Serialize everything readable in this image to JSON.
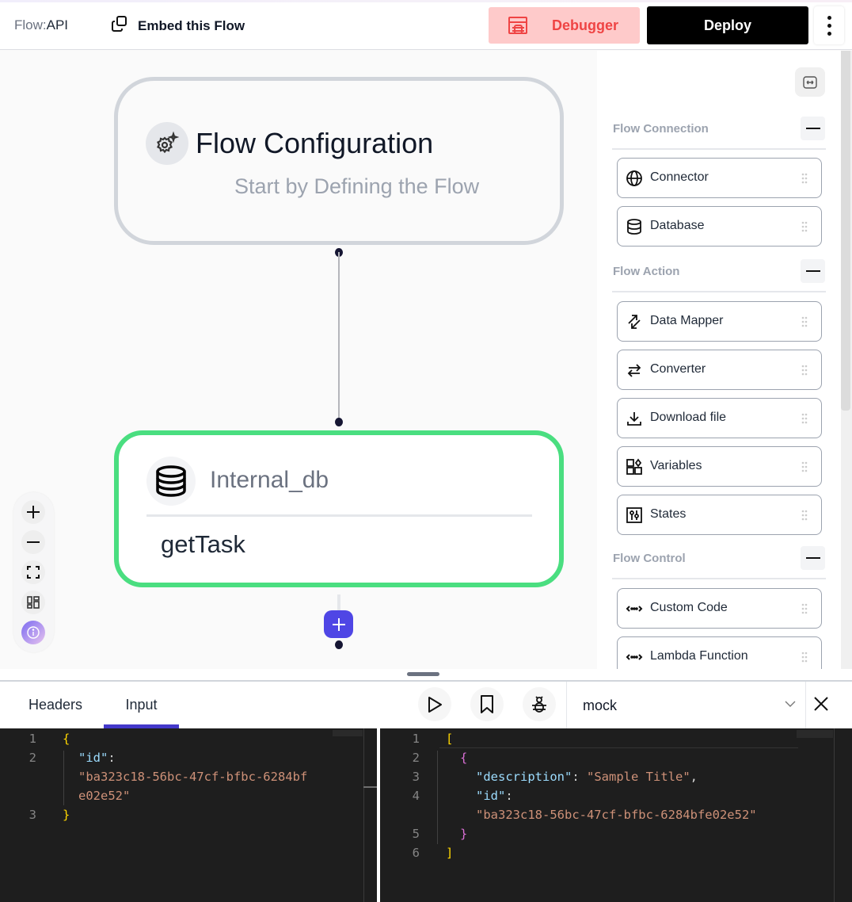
{
  "header": {
    "flow_prefix": "Flow:",
    "flow_name": "API",
    "embed_label": "Embed this Flow",
    "debugger_label": "Debugger",
    "deploy_label": "Deploy",
    "more_icon": "kebab-vertical-icon"
  },
  "canvas": {
    "config_node": {
      "icon": "gear-sparkle-icon",
      "title": "Flow Configuration",
      "subtitle": "Start by Defining the Flow"
    },
    "db_node": {
      "icon": "database-icon",
      "name": "Internal_db",
      "operation": "getTask",
      "border_color": "#4ade80"
    },
    "add_button_icon": "plus-icon",
    "accent_color": "#4f46e5"
  },
  "zoom_controls": [
    {
      "name": "zoom-in",
      "icon": "plus-icon"
    },
    {
      "name": "zoom-out",
      "icon": "minus-icon"
    },
    {
      "name": "fit-view",
      "icon": "fullscreen-icon"
    },
    {
      "name": "layout",
      "icon": "layout-icon"
    },
    {
      "name": "info",
      "icon": "info-icon"
    }
  ],
  "palette": {
    "collapse_icon": "expand-horizontal-icon",
    "sections": [
      {
        "title": "Flow Connection",
        "items": [
          {
            "label": "Connector",
            "icon": "globe-icon"
          },
          {
            "label": "Database",
            "icon": "database-icon"
          }
        ]
      },
      {
        "title": "Flow Action",
        "items": [
          {
            "label": "Data Mapper",
            "icon": "arrows-diagonal-icon"
          },
          {
            "label": "Converter",
            "icon": "arrows-swap-icon"
          },
          {
            "label": "Download file",
            "icon": "download-icon"
          },
          {
            "label": "Variables",
            "icon": "shapes-icon"
          },
          {
            "label": "States",
            "icon": "sliders-icon"
          }
        ]
      },
      {
        "title": "Flow Control",
        "items": [
          {
            "label": "Custom Code",
            "icon": "code-icon"
          },
          {
            "label": "Lambda Function",
            "icon": "code-icon"
          }
        ]
      }
    ]
  },
  "bottom_panel": {
    "tabs": [
      {
        "label": "Headers",
        "active": false
      },
      {
        "label": "Input",
        "active": true
      }
    ],
    "toolbar": {
      "run_icon": "play-icon",
      "save_icon": "bookmark-icon",
      "debug_icon": "bug-icon",
      "mock_value": "mock",
      "close_icon": "close-icon"
    },
    "input_editor": {
      "line_numbers": [
        "1",
        "2",
        "",
        "",
        "3"
      ],
      "key": "\"id\"",
      "colon": ":",
      "value_part1": "\"ba323c18-56bc-47cf-bfbc-6284bf",
      "value_part2": "e02e52\"",
      "open": "{",
      "close": "}"
    },
    "output_editor": {
      "line_numbers": [
        "1",
        "2",
        "3",
        "4",
        "",
        "5",
        "6"
      ],
      "open_array": "[",
      "open_obj": "{",
      "key1": "\"description\"",
      "value1": "\"Sample Title\"",
      "key2": "\"id\"",
      "value2": "\"ba323c18-56bc-47cf-bfbc-6284bfe02e52\"",
      "close_obj": "}",
      "close_array": "]"
    }
  }
}
